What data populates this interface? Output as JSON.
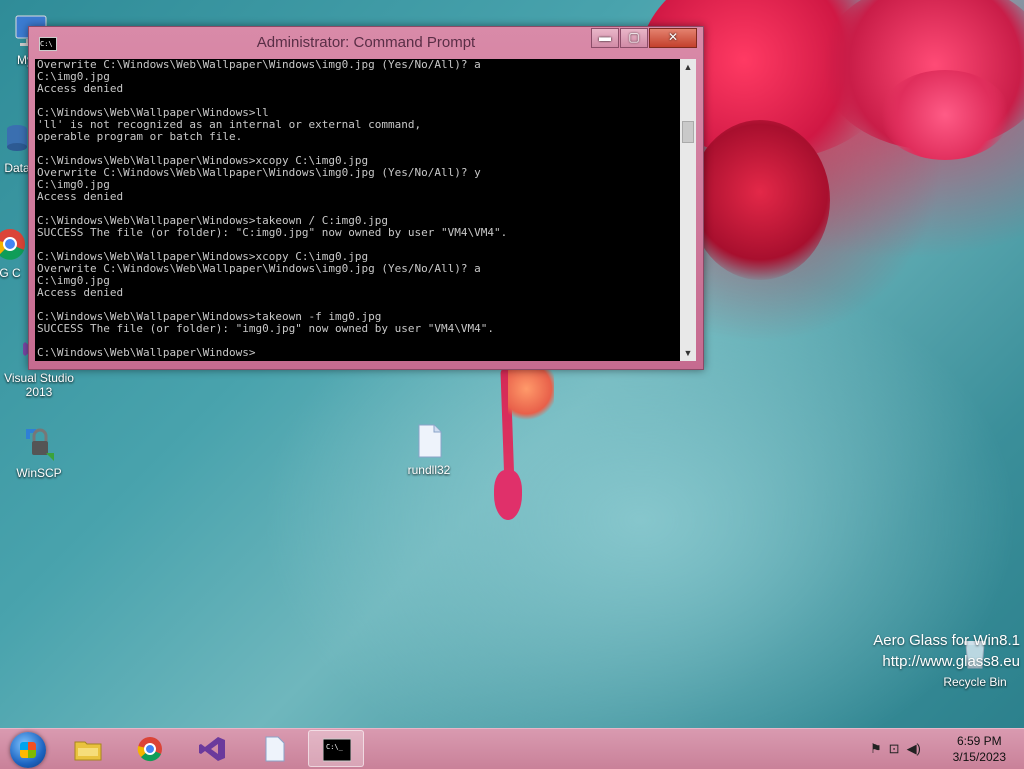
{
  "desktop": {
    "icons": [
      {
        "label": "My C"
      },
      {
        "label": "Data"
      },
      {
        "label": "G C"
      },
      {
        "label": "Visual Studio 2013"
      },
      {
        "label": "WinSCP"
      },
      {
        "label": "rundll32"
      },
      {
        "label": "Recycle Bin"
      }
    ],
    "watermark_line1": "Aero Glass for Win8.1",
    "watermark_line2": "http://www.glass8.eu"
  },
  "window": {
    "title": "Administrator: Command Prompt",
    "controls": {
      "minimize": "▬",
      "maximize": "▢",
      "close": "✕"
    },
    "console_lines": [
      "Overwrite C:\\Windows\\Web\\Wallpaper\\Windows\\img0.jpg (Yes/No/All)? a",
      "C:\\img0.jpg",
      "Access denied",
      "",
      "C:\\Windows\\Web\\Wallpaper\\Windows>ll",
      "'ll' is not recognized as an internal or external command,",
      "operable program or batch file.",
      "",
      "C:\\Windows\\Web\\Wallpaper\\Windows>xcopy C:\\img0.jpg",
      "Overwrite C:\\Windows\\Web\\Wallpaper\\Windows\\img0.jpg (Yes/No/All)? y",
      "C:\\img0.jpg",
      "Access denied",
      "",
      "C:\\Windows\\Web\\Wallpaper\\Windows>takeown / C:img0.jpg",
      "SUCCESS The file (or folder): \"C:img0.jpg\" now owned by user \"VM4\\VM4\".",
      "",
      "C:\\Windows\\Web\\Wallpaper\\Windows>xcopy C:\\img0.jpg",
      "Overwrite C:\\Windows\\Web\\Wallpaper\\Windows\\img0.jpg (Yes/No/All)? a",
      "C:\\img0.jpg",
      "Access denied",
      "",
      "C:\\Windows\\Web\\Wallpaper\\Windows>takeown -f img0.jpg",
      "SUCCESS The file (or folder): \"img0.jpg\" now owned by user \"VM4\\VM4\".",
      "",
      "C:\\Windows\\Web\\Wallpaper\\Windows>"
    ]
  },
  "taskbar": {
    "clock_time": "6:59 PM",
    "clock_date": "3/15/2023",
    "tray_icons": [
      "flag-icon",
      "network-icon",
      "volume-icon"
    ],
    "pinned": [
      "file-explorer-icon",
      "chrome-icon",
      "visual-studio-icon",
      "document-icon",
      "command-prompt-icon"
    ],
    "active_item": "command-prompt-icon"
  },
  "colors": {
    "window_frame": "#c66b90",
    "console_bg": "#000000",
    "console_text": "#c8c8c8",
    "taskbar": "#d99ab0"
  }
}
